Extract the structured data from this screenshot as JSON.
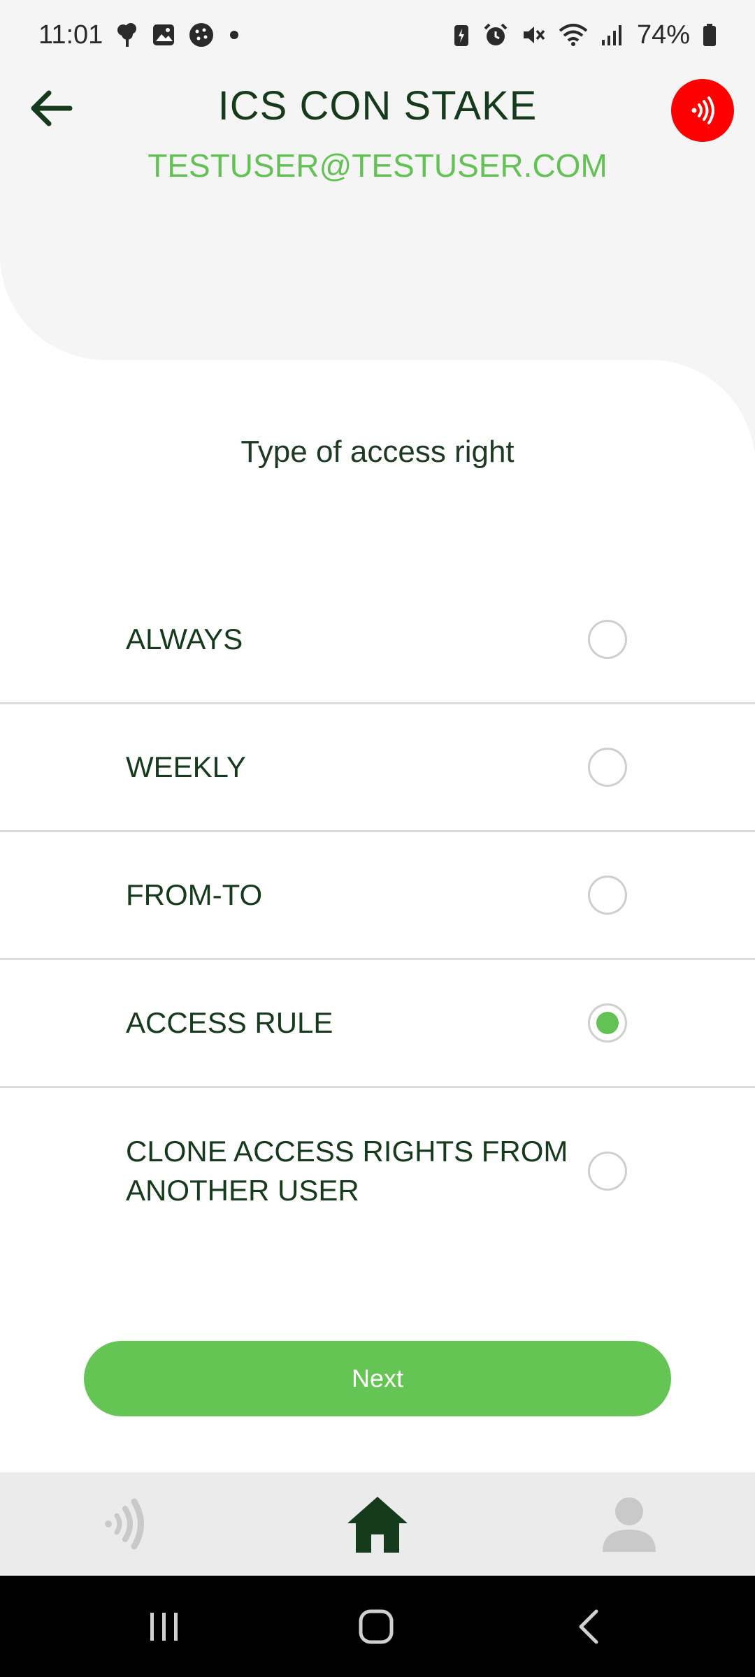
{
  "status_bar": {
    "time": "11:01",
    "battery": "74%",
    "left_icons": [
      "tree-icon",
      "gallery-icon",
      "cookie-icon",
      "dot-icon"
    ],
    "right_icons": [
      "battery-saver-icon",
      "alarm-icon",
      "mute-icon",
      "wifi-icon",
      "signal-icon",
      "battery-icon"
    ]
  },
  "app_bar": {
    "title": "ICS CON STAKE",
    "subtitle": "TESTUSER@TESTUSER.COM"
  },
  "section": {
    "title": "Type of access right"
  },
  "options": [
    {
      "label": "ALWAYS",
      "selected": false
    },
    {
      "label": "WEEKLY",
      "selected": false
    },
    {
      "label": "FROM-TO",
      "selected": false
    },
    {
      "label": "ACCESS RULE",
      "selected": true
    },
    {
      "label": "CLONE ACCESS RIGHTS FROM ANOTHER USER",
      "selected": false
    }
  ],
  "actions": {
    "next_label": "Next"
  },
  "tab_bar": {
    "items": [
      "nfc-icon",
      "home-icon",
      "profile-icon"
    ],
    "active": "home-icon"
  },
  "colors": {
    "accent_green": "#63c254",
    "dark_green": "#163a1c",
    "nfc_red": "#ff0000",
    "header_grey": "#f5f5f5"
  }
}
